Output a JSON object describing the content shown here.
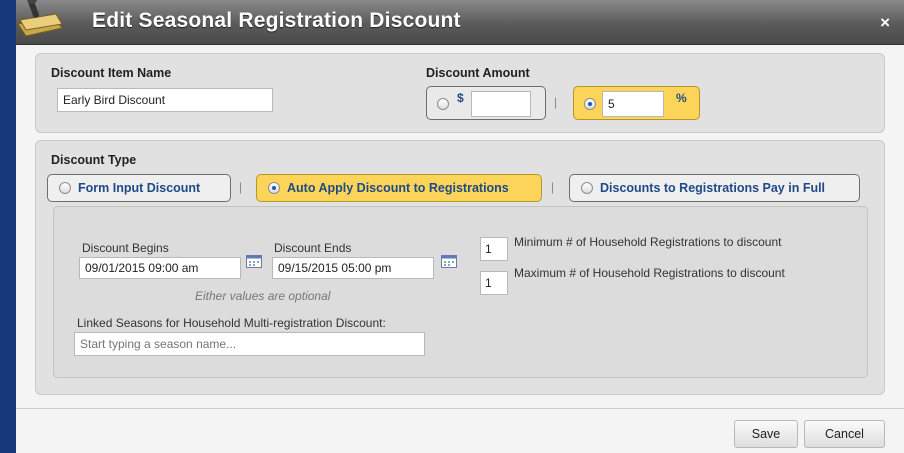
{
  "dialog": {
    "title": "Edit Seasonal Registration Discount",
    "close_label": "×"
  },
  "discount_item": {
    "label": "Discount Item Name",
    "value": "Early Bird Discount"
  },
  "discount_amount": {
    "label": "Discount Amount",
    "dollar_unit": "$",
    "dollar_value": "",
    "separator": "|",
    "percent_unit": "%",
    "percent_value": "5",
    "selected": "percent"
  },
  "discount_type": {
    "label": "Discount Type",
    "separator": "|",
    "options": [
      {
        "label": "Form Input Discount",
        "selected": false
      },
      {
        "label": "Auto Apply Discount to Registrations",
        "selected": true
      },
      {
        "label": "Discounts to Registrations Pay in Full",
        "selected": false
      }
    ]
  },
  "auto_apply": {
    "begins_label": "Discount Begins",
    "begins_value": "09/01/2015 09:00 am",
    "ends_label": "Discount Ends",
    "ends_value": "09/15/2015 05:00 pm",
    "optional_hint": "Either values are optional",
    "min_value": "1",
    "min_label": "Minimum # of Household Registrations to discount",
    "max_value": "1",
    "max_label": "Maximum # of Household Registrations to discount",
    "linked_label": "Linked Seasons for Household Multi-registration Discount:",
    "linked_placeholder": "Start typing a season name..."
  },
  "footer": {
    "save_label": "Save",
    "cancel_label": "Cancel"
  },
  "colors": {
    "selected_option": "#fcd45a",
    "option_text": "#1f4a87",
    "titlebar": "#5a5a5a",
    "backdrop": "#1a3d82"
  },
  "icons": {
    "title": "wrench-on-card-icon",
    "close": "close-icon",
    "calendar": "calendar-icon"
  }
}
